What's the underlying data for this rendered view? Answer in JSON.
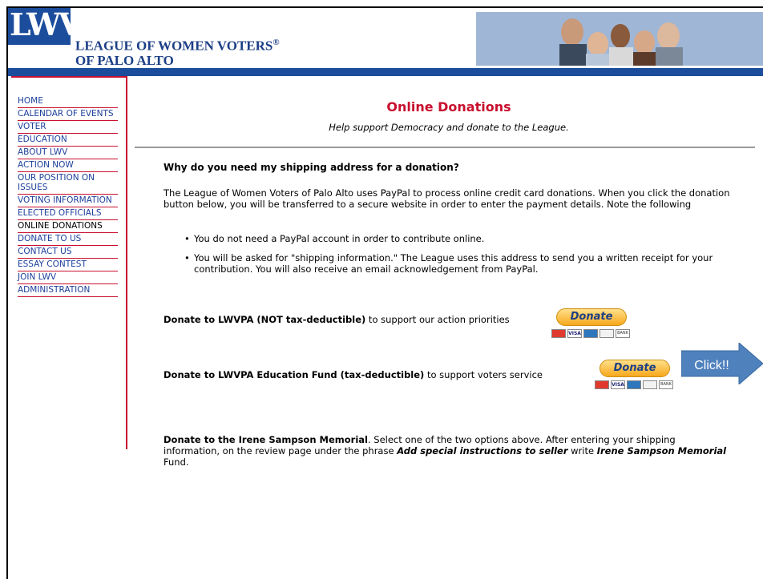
{
  "header": {
    "logo_text": "LWV",
    "org_name_line1": "LEAGUE OF WOMEN VOTERS",
    "org_name_reg": "®",
    "org_name_line2": "OF PALO ALTO"
  },
  "sidebar": {
    "items": [
      {
        "label": "HOME"
      },
      {
        "label": "CALENDAR OF EVENTS"
      },
      {
        "label": "VOTER"
      },
      {
        "label": "EDUCATION"
      },
      {
        "label": "ABOUT LWV"
      },
      {
        "label": "ACTION NOW"
      },
      {
        "label": "OUR POSITION ON ISSUES"
      },
      {
        "label": "VOTING INFORMATION"
      },
      {
        "label": "ELECTED OFFICIALS"
      },
      {
        "label": "ONLINE DONATIONS",
        "active": true
      },
      {
        "label": "DONATE TO US"
      },
      {
        "label": "CONTACT US"
      },
      {
        "label": "ESSAY CONTEST"
      },
      {
        "label": "JOIN LWV"
      },
      {
        "label": "ADMINISTRATION"
      }
    ]
  },
  "main": {
    "title": "Online Donations",
    "subtitle": "Help support Democracy and donate to the League.",
    "question": "Why do you need my shipping address for a donation?",
    "intro": "The League of Women Voters of Palo Alto uses PayPal to process online credit card donations. When you click the donation button below, you will be transferred to a secure website in order to enter the payment details. Note the following",
    "bullets": [
      "You do not need a PayPal account in order to contribute online.",
      "You will be asked for \"shipping information.\" The League uses this address to send you a written receipt for your contribution. You will also receive an email acknowledgement from PayPal."
    ],
    "donate1": {
      "bold": "Donate to LWVPA (NOT tax-deductible)",
      "rest": " to support our action priorities",
      "button": "Donate"
    },
    "donate2": {
      "bold": "Donate to LWVPA Education Fund (tax-deductible)",
      "rest": " to support voters service",
      "button": "Donate"
    },
    "card_labels": [
      "VISA",
      "BANK"
    ],
    "callout": "Click!!",
    "memorial": {
      "bold": "Donate to the Irene Sampson Memorial",
      "text1": ". Select one of the two options above. After entering your shipping information, on the review page under the phrase ",
      "bi1": "Add special instructions to seller",
      "text2": " write ",
      "bi2": "Irene Sampson Memorial",
      "text3": " Fund."
    }
  },
  "colors": {
    "brand_blue": "#1c4d9c",
    "accent_red": "#c8102e",
    "link_blue": "#1c3f9c",
    "callout_blue": "#4f81bd"
  }
}
